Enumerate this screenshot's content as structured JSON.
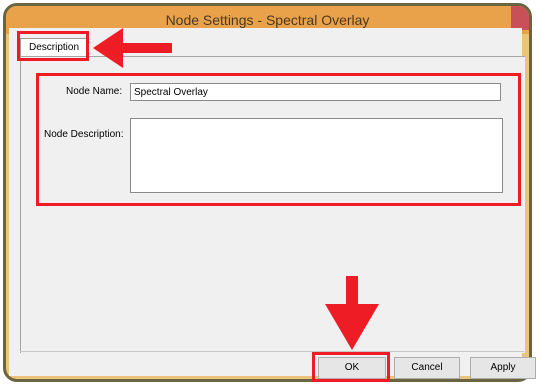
{
  "window": {
    "title": "Node Settings - Spectral Overlay"
  },
  "tabs": [
    {
      "label": "Description"
    }
  ],
  "form": {
    "node_name_label": "Node Name:",
    "node_name_value": "Spectral Overlay",
    "node_description_label": "Node Description:",
    "node_description_value": ""
  },
  "buttons": {
    "ok": "OK",
    "cancel": "Cancel",
    "apply": "Apply"
  },
  "annotation_color": "#ee1c24"
}
